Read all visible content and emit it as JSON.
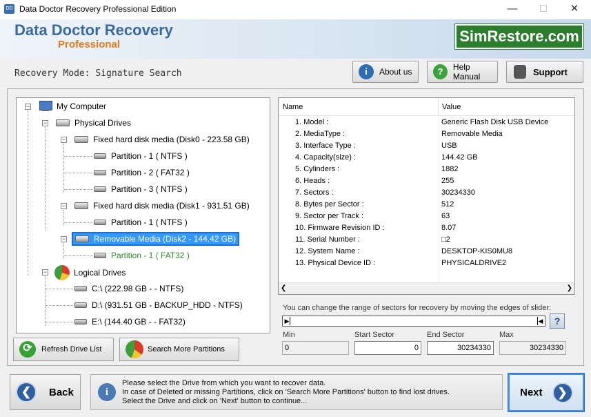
{
  "window": {
    "title": "Data Doctor Recovery Professional Edition",
    "icon": "app-icon",
    "minimize": "—",
    "maximize": "☐",
    "close": "✕"
  },
  "header": {
    "brand_line1": "Data Doctor Recovery",
    "brand_line2": "Professional",
    "logo": "SimRestore.com"
  },
  "mode": {
    "text": "Recovery Mode: Signature Search"
  },
  "toolbar": {
    "about_label": "About us",
    "help_label": "Help Manual",
    "support_label": "Support"
  },
  "tree": {
    "my_computer": "My Computer",
    "physical_drives": "Physical Drives",
    "disk0": "Fixed hard disk media (Disk0 - 223.58 GB)",
    "disk0_p1": "Partition - 1 ( NTFS )",
    "disk0_p2": "Partition - 2 ( FAT32 )",
    "disk0_p3": "Partition - 3 ( NTFS )",
    "disk1": "Fixed hard disk media (Disk1 - 931.51 GB)",
    "disk1_p1": "Partition - 1 ( NTFS )",
    "disk2": "Removable Media (Disk2 - 144.42 GB)",
    "disk2_p1": "Partition - 1 ( FAT32 )",
    "logical_drives": "Logical Drives",
    "c_drive": "C:\\ (222.98 GB -  - NTFS)",
    "d_drive": "D:\\ (931.51 GB - BACKUP_HDD - NTFS)",
    "e_drive": "E:\\ (144.40 GB -  - FAT32)"
  },
  "properties": {
    "col_name": "Name",
    "col_value": "Value",
    "rows": [
      {
        "name": "1. Model :",
        "value": "Generic Flash Disk USB Device"
      },
      {
        "name": "2. MediaType :",
        "value": "Removable Media"
      },
      {
        "name": "3. Interface Type :",
        "value": "USB"
      },
      {
        "name": "4. Capacity(size) :",
        "value": "144.42 GB"
      },
      {
        "name": "5. Cylinders :",
        "value": "1882"
      },
      {
        "name": "6. Heads :",
        "value": "255"
      },
      {
        "name": "7. Sectors :",
        "value": "30234330"
      },
      {
        "name": "8. Bytes per Sector :",
        "value": "512"
      },
      {
        "name": "9. Sector per Track :",
        "value": "63"
      },
      {
        "name": "10. Firmware Revision ID :",
        "value": "8.07"
      },
      {
        "name": "11. Serial Number :",
        "value": "□2"
      },
      {
        "name": "12. System Name :",
        "value": "DESKTOP-KIS0MU8"
      },
      {
        "name": "13. Physical Device ID :",
        "value": "PHYSICALDRIVE2"
      }
    ]
  },
  "range": {
    "instruction": "You can change the range of sectors for recovery by moving the edges of slider:",
    "help": "?",
    "min_label": "Min",
    "min_value": "0",
    "start_label": "Start Sector",
    "start_value": "0",
    "end_label": "End Sector",
    "end_value": "30234330",
    "max_label": "Max",
    "max_value": "30234330"
  },
  "buttons": {
    "refresh": "Refresh Drive List",
    "search_more": "Search More Partitions",
    "back": "Back",
    "next": "Next"
  },
  "info": {
    "line1": "Please select the Drive from which you want to recover data.",
    "line2": "In case of Deleted or missing Partitions, click on 'Search More Partitions' button to find lost drives.",
    "line3": "Select the Drive and click on 'Next' button to continue..."
  }
}
